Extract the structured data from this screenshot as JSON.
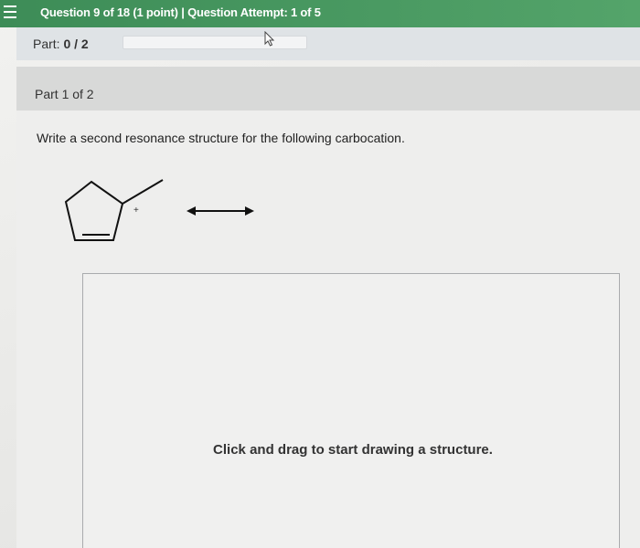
{
  "header": {
    "title": "Question 9 of 18 (1 point)  |  Question Attempt: 1 of 5"
  },
  "part_progress": {
    "label_prefix": "Part: ",
    "label_value": "0 / 2",
    "progress_fraction": 0
  },
  "part_panel": {
    "title": "Part 1 of 2"
  },
  "question": {
    "prompt": "Write a second resonance structure for the following carbocation.",
    "charge_symbol": "+"
  },
  "drawing_area": {
    "prompt": "Click and drag to start drawing a structure."
  },
  "icons": {
    "menu": "hamburger-menu-icon",
    "cursor": "pointer-cursor-icon",
    "resonance_arrow": "double-headed-arrow-icon"
  },
  "colors": {
    "header_green": "#4a9a62",
    "strip_gray": "#dfe3e6",
    "panel_gray": "#d8d9d8"
  }
}
